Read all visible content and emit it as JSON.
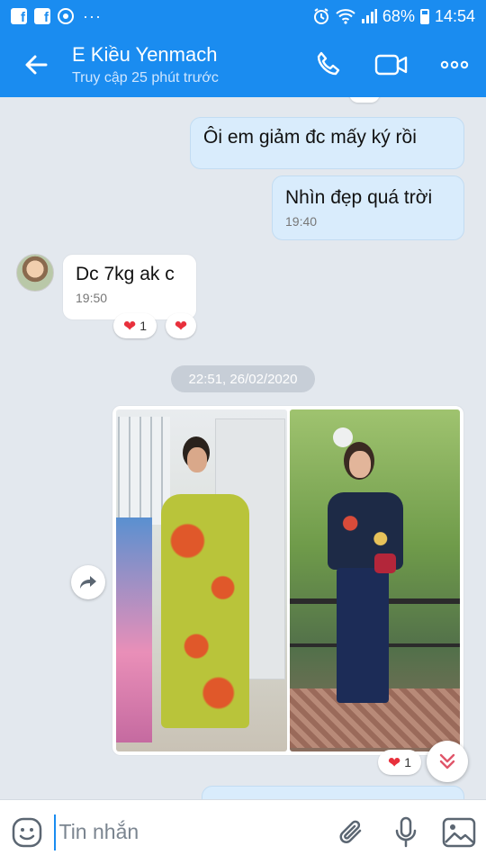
{
  "status_bar": {
    "battery": "68%",
    "time": "14:54",
    "notification_icons": [
      "facebook-icon",
      "facebook-icon",
      "chrome-icon"
    ],
    "more": "···"
  },
  "header": {
    "contact_name": "E  Kiều Yenmach",
    "last_seen": "Truy cập 25 phút trước",
    "icons": [
      "back-arrow-icon",
      "phone-icon",
      "video-call-icon",
      "more-icon"
    ]
  },
  "messages": [
    {
      "direction": "out",
      "text": "Ôi em giảm đc mấy ký rồi",
      "time": ""
    },
    {
      "direction": "out",
      "text": "Nhìn đẹp quá trời",
      "time": "19:40"
    },
    {
      "direction": "in",
      "text": "Dc 7kg ak c",
      "time": "19:50",
      "reaction_count": "1"
    }
  ],
  "date_separator": "22:51, 26/02/2020",
  "photo_message": {
    "reaction_count": "1"
  },
  "input": {
    "placeholder": "Tin nhắn"
  },
  "colors": {
    "accent": "#1a8cf0",
    "outgoing_bubble": "#d9ecfc",
    "background": "#e3e8ee",
    "heart": "#e8303c"
  }
}
